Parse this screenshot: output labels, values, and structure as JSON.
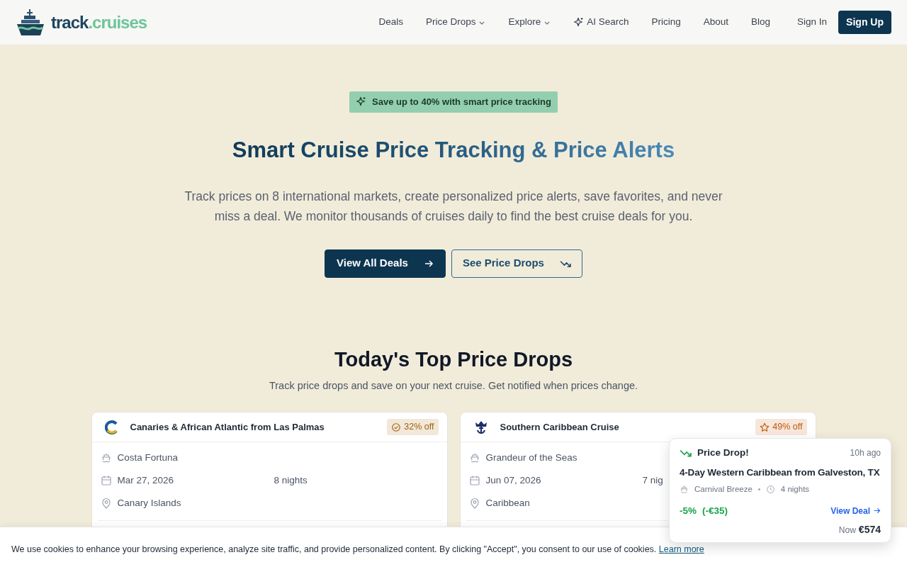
{
  "logo": {
    "primary": "track",
    "secondary": ".cruises"
  },
  "nav": [
    {
      "label": "Deals",
      "kind": "link"
    },
    {
      "label": "Price Drops",
      "kind": "menu"
    },
    {
      "label": "Explore",
      "kind": "menu"
    },
    {
      "label": "AI Search",
      "kind": "sparkle"
    },
    {
      "label": "Pricing",
      "kind": "link"
    },
    {
      "label": "About",
      "kind": "link"
    },
    {
      "label": "Blog",
      "kind": "link"
    }
  ],
  "sign_in": "Sign In",
  "sign_up": "Sign Up",
  "hero": {
    "badge": "Save up to 40% with smart price tracking",
    "title": "Smart Cruise Price Tracking & Price Alerts",
    "text": "Track prices on 8 international markets, create personalized price alerts, save favorites, and never miss a deal. We monitor thousands of cruises daily to find the best cruise deals for you.",
    "primary_button": "View All Deals",
    "secondary_button": "See Price Drops"
  },
  "section": {
    "title": "Today's Top Price Drops",
    "subtitle": "Track price drops and save on your next cruise. Get notified when prices change."
  },
  "cards": [
    {
      "title": "Canaries & African Atlantic from Las Palmas",
      "badge": {
        "text": "32% off",
        "color": "#a16207"
      },
      "ship": "Costa Fortuna",
      "date": "Mar 27, 2026",
      "nights": "8 nights",
      "region": "Canary Islands"
    },
    {
      "title": "Southern Caribbean Cruise",
      "badge": {
        "text": "49% off",
        "color": "#c2570c"
      },
      "ship": "Grandeur of the Seas",
      "date": "Jun 07, 2026",
      "nights": "7 nig",
      "region": "Caribbean"
    }
  ],
  "toast": {
    "title": "Price Drop!",
    "time": "10h ago",
    "route": "4-Day Western Caribbean from Galveston, TX",
    "ship": "Carnival Breeze",
    "nights": "4 nights",
    "change_pct": "-5%",
    "change_amount": "(-€35)",
    "link": "View Deal",
    "price_label": "Now",
    "price": "€574"
  },
  "cookie": {
    "text": "We use cookies to enhance your browsing experience, analyze site traffic, and provide personalized content. By clicking \"Accept\", you consent to our use of cookies.",
    "link": "Learn more"
  }
}
